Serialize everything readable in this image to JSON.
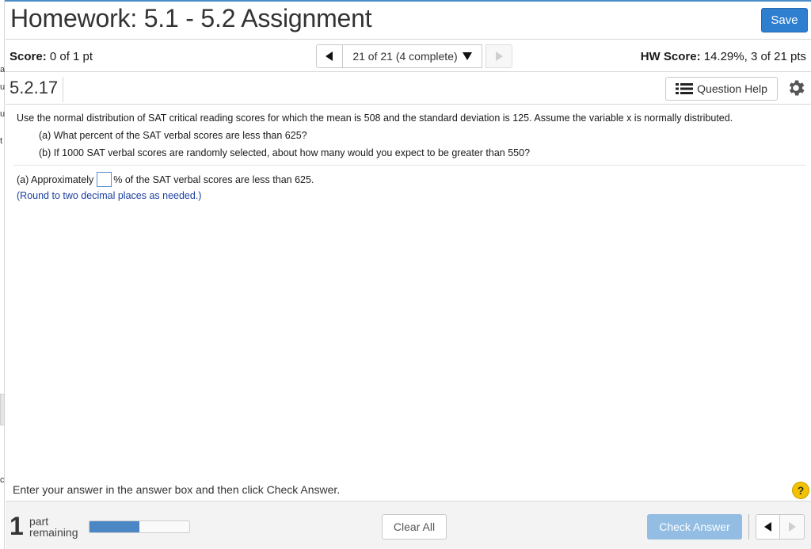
{
  "colors": {
    "accent": "#2f7fd0",
    "hint_text": "#1a3fa0",
    "progress_fill": "#4a87c4",
    "check_button_disabled": "#93bde3",
    "help_badge": "#f2c200"
  },
  "header": {
    "title": "Homework: 5.1 - 5.2 Assignment",
    "save_label": "Save"
  },
  "score_bar": {
    "score_label": "Score:",
    "score_value": "0 of 1 pt",
    "nav_position": "21 of 21 (4 complete)",
    "hw_score_label": "HW Score:",
    "hw_score_value": "14.29%, 3 of 21 pts",
    "prev_icon": "triangle-left-icon",
    "next_icon": "triangle-right-icon",
    "dropdown_icon": "triangle-down-icon"
  },
  "question_header": {
    "number": "5.2.17",
    "help_label": "Question Help",
    "help_icon": "list-icon",
    "settings_icon": "gear-icon"
  },
  "question": {
    "stem": "Use the normal distribution of SAT critical reading scores for which the mean is 508 and the standard deviation is 125. Assume the variable x is normally distributed.",
    "part_a": "(a) What percent of the SAT verbal scores are less than 625?",
    "part_b": "(b) If 1000 SAT verbal scores are randomly selected, about how many would you expect to be greater than 550?"
  },
  "answer": {
    "prefix": "(a) Approximately",
    "value": "",
    "suffix": "% of the SAT verbal scores are less than 625.",
    "hint": "(Round to two decimal places as needed.)"
  },
  "instructions": {
    "text": "Enter your answer in the answer box and then click Check Answer.",
    "help_badge": "?"
  },
  "footer": {
    "parts_remaining_count": "1",
    "parts_line1": "part",
    "parts_line2": "remaining",
    "progress_fraction": 0.5,
    "clear_label": "Clear All",
    "check_label": "Check Answer"
  },
  "left_edge_fragments": [
    "a",
    "u",
    "u",
    "t",
    "c"
  ]
}
